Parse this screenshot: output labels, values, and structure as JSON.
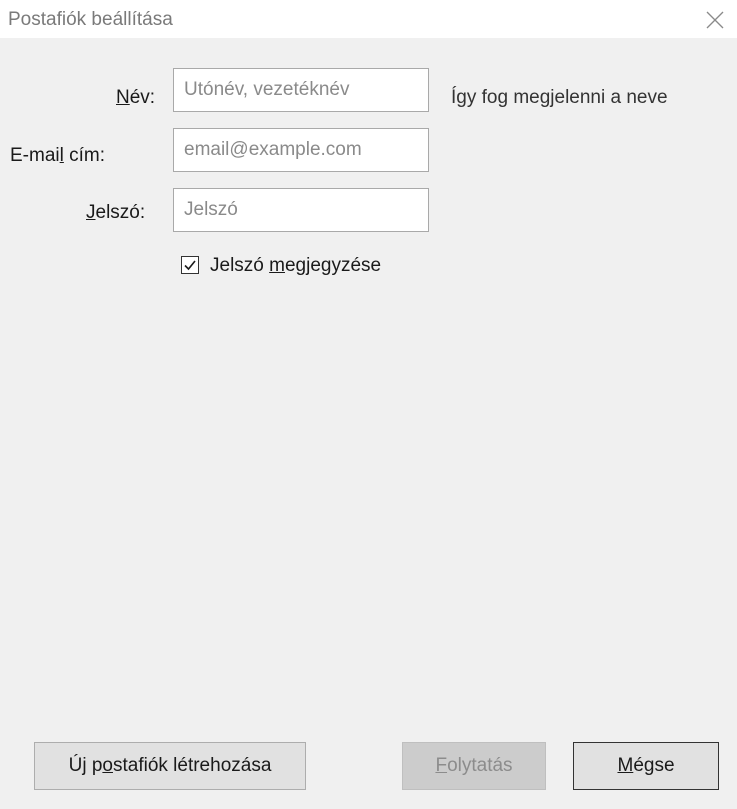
{
  "window": {
    "title": "Postafiók beállítása",
    "close_icon": "close-icon"
  },
  "form": {
    "name": {
      "label_underlined": "N",
      "label_rest": "év:",
      "placeholder": "Utónév, vezetéknév",
      "value": "",
      "hint": "Így fog megjelenni a neve"
    },
    "email": {
      "label_before": "E-mai",
      "label_underlined": "l",
      "label_after": " cím:",
      "placeholder": "email@example.com",
      "value": ""
    },
    "password": {
      "label_underlined": "J",
      "label_rest": "elszó:",
      "placeholder": "Jelszó",
      "value": ""
    },
    "remember": {
      "checked": true,
      "label_before": "Jelszó ",
      "label_underlined": "m",
      "label_after": "egjegyzése"
    }
  },
  "buttons": {
    "new_account": {
      "before": "Új p",
      "underlined": "o",
      "after": "stafiók létrehozása"
    },
    "continue": {
      "underlined": "F",
      "after": "olytatás",
      "disabled": true
    },
    "cancel": {
      "before": "",
      "underlined": "M",
      "after": "égse"
    }
  }
}
